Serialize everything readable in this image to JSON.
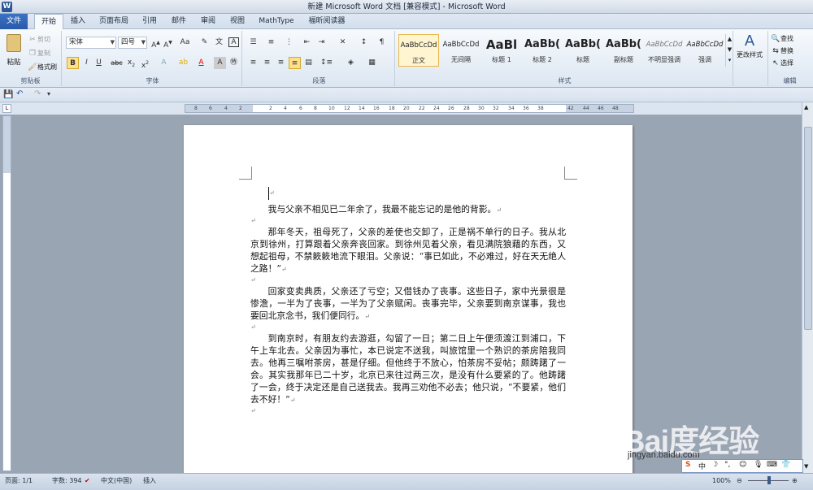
{
  "title": "新建 Microsoft Word 文档 [兼容模式] - Microsoft Word",
  "tabs": [
    "文件",
    "开始",
    "插入",
    "页面布局",
    "引用",
    "邮件",
    "审阅",
    "视图",
    "MathType",
    "福昕阅读器"
  ],
  "clipboard": {
    "paste": "粘贴",
    "cut": "剪切",
    "copy": "复制",
    "format_painter": "格式刷",
    "label": "剪贴板"
  },
  "font": {
    "name": "宋体",
    "size": "四号",
    "label": "字体"
  },
  "paragraph": {
    "label": "段落"
  },
  "styles": {
    "label": "样式",
    "items": [
      {
        "sample": "AaBbCcDd",
        "name": "正文"
      },
      {
        "sample": "AaBbCcDd",
        "name": "无间隔"
      },
      {
        "sample": "AaBl",
        "name": "标题 1"
      },
      {
        "sample": "AaBb(",
        "name": "标题 2"
      },
      {
        "sample": "AaBb(",
        "name": "标题"
      },
      {
        "sample": "AaBb(",
        "name": "副标题"
      },
      {
        "sample": "AaBbCcDd",
        "name": "不明显强调"
      },
      {
        "sample": "AaBbCcDd",
        "name": "强调"
      }
    ],
    "change": "更改样式"
  },
  "editing": {
    "find": "查找",
    "replace": "替换",
    "select": "选择",
    "label": "编辑"
  },
  "document": {
    "line1": "我与父亲不相见已二年余了，我最不能忘记的是他的背影。",
    "para2": "那年冬天，祖母死了，父亲的差使也交卸了，正是祸不单行的日子。我从北京到徐州，打算跟着父亲奔丧回家。到徐州见着父亲，看见满院狼藉的东西，又想起祖母，不禁簌簌地流下眼泪。父亲说：“事已如此，不必难过，好在天无绝人之路！”",
    "para3": "回家变卖典质，父亲还了亏空；又借钱办了丧事。这些日子，家中光景很是惨澹，一半为了丧事，一半为了父亲赋闲。丧事完毕，父亲要到南京谋事，我也要回北京念书，我们便同行。",
    "para4": "到南京时，有朋友约去游逛，勾留了一日；第二日上午便须渡江到浦口，下午上车北去。父亲因为事忙，本已说定不送我，叫旅馆里一个熟识的茶房陪我同去。他再三嘱咐茶房，甚是仔细。但他终于不放心，怕茶房不妥帖；颇踌躇了一会。其实我那年已二十岁，北京已来往过两三次，是没有什么要紧的了。他踌躇了一会，终于决定还是自己送我去。我再三劝他不必去；他只说，“不要紧，他们去不好！”"
  },
  "status": {
    "page": "页面: 1/1",
    "words": "字数: 394",
    "language": "中文(中国)",
    "mode": "插入",
    "zoom": "100%"
  },
  "watermark": {
    "main": "Bai度经验",
    "sub": "jingyan.baidu.com"
  },
  "ruler_ticks": [
    "8",
    "6",
    "4",
    "2",
    "",
    "2",
    "4",
    "6",
    "8",
    "10",
    "12",
    "14",
    "16",
    "18",
    "20",
    "22",
    "24",
    "26",
    "28",
    "30",
    "32",
    "34",
    "36",
    "38",
    "",
    "42",
    "44",
    "46",
    "48"
  ]
}
